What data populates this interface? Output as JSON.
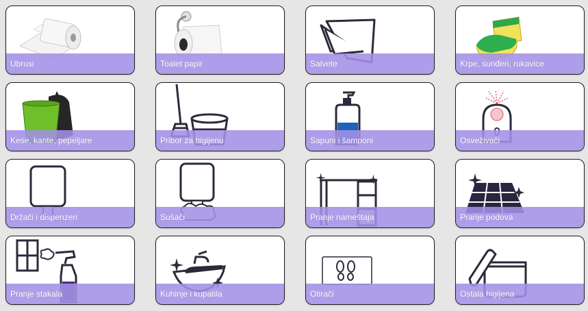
{
  "colors": {
    "band": "#a391e6",
    "border": "#1c1c1c",
    "page_background": "#e6e6e6",
    "icon_ink": "#2a2a3a"
  },
  "categories": [
    {
      "label": "Ubrusi",
      "icon": "paper-towel-roll-icon"
    },
    {
      "label": "Toalet papir",
      "icon": "toilet-paper-holder-icon"
    },
    {
      "label": "Salvete",
      "icon": "napkins-icon"
    },
    {
      "label": "Krpe, sunđeri, rukavice",
      "icon": "sponge-icon"
    },
    {
      "label": "Kese, kante, pepeljare",
      "icon": "trash-bin-bag-icon"
    },
    {
      "label": "Pribor za higijenu",
      "icon": "broom-bucket-icon"
    },
    {
      "label": "Sapuni i šamponi",
      "icon": "soap-dispenser-icon"
    },
    {
      "label": "Osveživači",
      "icon": "air-freshener-icon"
    },
    {
      "label": "Držači i dispenzeri",
      "icon": "towel-dispenser-icon"
    },
    {
      "label": "Sušači",
      "icon": "hand-dryer-icon"
    },
    {
      "label": "Pranje nameštaja",
      "icon": "desk-icon"
    },
    {
      "label": "Pranje podova",
      "icon": "floor-tiles-icon"
    },
    {
      "label": "Pranje stakala",
      "icon": "window-spray-icon"
    },
    {
      "label": "Kuhinje i kupatila",
      "icon": "sink-faucet-icon"
    },
    {
      "label": "Otirači",
      "icon": "doormat-icon"
    },
    {
      "label": "Ostala higijena",
      "icon": "jar-icon"
    }
  ]
}
